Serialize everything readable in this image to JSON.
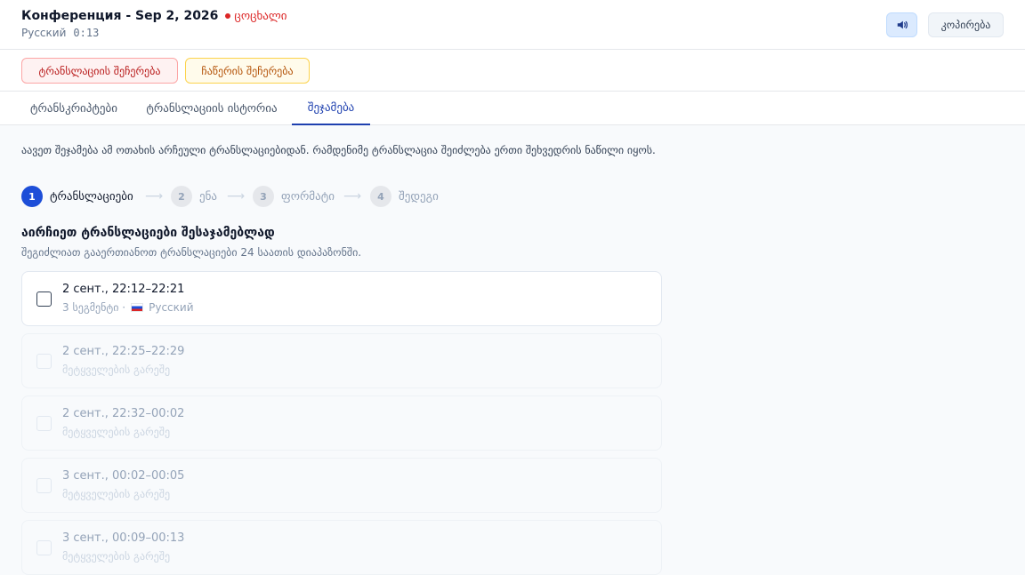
{
  "header": {
    "title": "Конференция - Sep 2, 2026",
    "live_label": "ცოცხალი",
    "language": "Русский",
    "timer": "0:13",
    "speaker_icon": "speaker-icon",
    "copy_label": "კოპირება"
  },
  "actions": {
    "stop_translation": "ტრანსლაციის შეჩერება",
    "stop_recording": "ჩაწერის შეჩერება"
  },
  "tabs": [
    {
      "label": "ტრანსკრიპტები"
    },
    {
      "label": "ტრანსლაციის ისტორია"
    },
    {
      "label": "შეჯამება"
    }
  ],
  "intro": "აავეთ შეჯამება ამ ოთახის არჩეული ტრანსლაციებიდან. რამდენიმე ტრანსლაცია შეიძლება ერთი შეხვედრის ნაწილი იყოს.",
  "steps": [
    {
      "num": "1",
      "label": "ტრანსლაციები"
    },
    {
      "num": "2",
      "label": "ენა"
    },
    {
      "num": "3",
      "label": "ფორმატი"
    },
    {
      "num": "4",
      "label": "შედეგი"
    }
  ],
  "arrow_glyph": "⟶",
  "section": {
    "title": "აირჩიეთ ტრანსლაციები შესაჯამებლად",
    "hint": "შეგიძლიათ გააერთიანოთ ტრანსლაციები 24 საათის დიაპაზონში."
  },
  "sessions": [
    {
      "time": "2 сент., 22:12–22:21",
      "segments": "3 სეგმენტი ·",
      "language": "Русский",
      "enabled": true
    },
    {
      "time": "2 сент., 22:25–22:29",
      "note": "მეტყველების გარეშე",
      "enabled": false
    },
    {
      "time": "2 сент., 22:32–00:02",
      "note": "მეტყველების გარეშე",
      "enabled": false
    },
    {
      "time": "3 сент., 00:02–00:05",
      "note": "მეტყველების გარეშე",
      "enabled": false
    },
    {
      "time": "3 сент., 00:09–00:13",
      "note": "მეტყველების გარეშე",
      "enabled": false
    }
  ],
  "colors": {
    "accent": "#1d4ed8",
    "live": "#dc2626"
  }
}
